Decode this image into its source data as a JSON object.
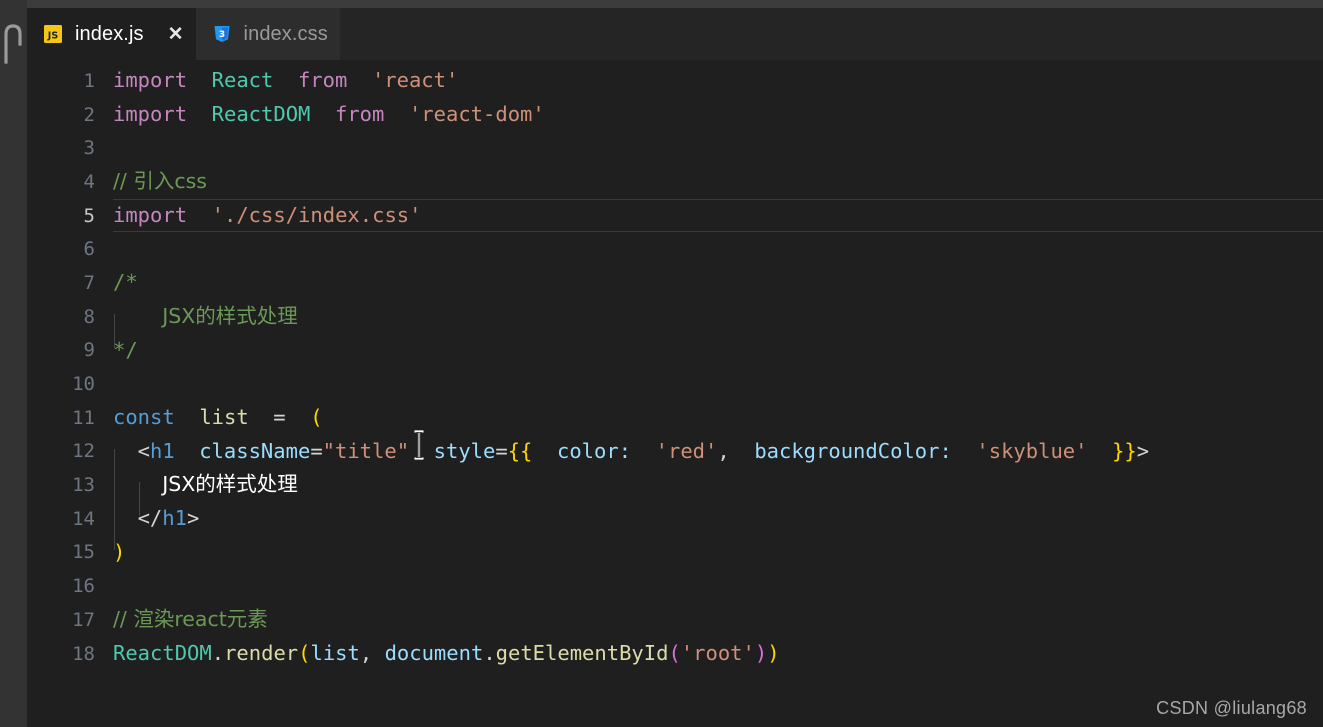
{
  "window": {
    "active_file": "index.js",
    "theme_bg": "#1f1f1f",
    "accent": "#569cd6"
  },
  "activity_bar": {
    "icon_name": "explorer-icon"
  },
  "tabs": [
    {
      "label": "index.js",
      "icon": "javascript-file-icon",
      "icon_text": "JS",
      "active": true,
      "close_label": "✕"
    },
    {
      "label": "index.css",
      "icon": "css-file-icon",
      "icon_text": "3",
      "active": false,
      "close_label": ""
    }
  ],
  "editor": {
    "language": "javascript",
    "current_line": 5,
    "cursor_marker": "text-ibeam",
    "lines": [
      {
        "n": "1",
        "text": "import React from 'react'"
      },
      {
        "n": "2",
        "text": "import ReactDOM from 'react-dom'"
      },
      {
        "n": "3",
        "text": ""
      },
      {
        "n": "4",
        "text": "// 引入css"
      },
      {
        "n": "5",
        "text": "import './css/index.css'"
      },
      {
        "n": "6",
        "text": ""
      },
      {
        "n": "7",
        "text": "/*"
      },
      {
        "n": "8",
        "text": "   JSX的样式处理"
      },
      {
        "n": "9",
        "text": "*/"
      },
      {
        "n": "10",
        "text": ""
      },
      {
        "n": "11",
        "text": "const list = ("
      },
      {
        "n": "12",
        "text": "  <h1 className=\"title\" style={{ color: 'red', backgroundColor: 'skyblue' }}>"
      },
      {
        "n": "13",
        "text": "    JSX的样式处理"
      },
      {
        "n": "14",
        "text": "  </h1>"
      },
      {
        "n": "15",
        "text": ")"
      },
      {
        "n": "16",
        "text": ""
      },
      {
        "n": "17",
        "text": "// 渲染react元素"
      },
      {
        "n": "18",
        "text": "ReactDOM.render(list, document.getElementById('root'))"
      }
    ],
    "tokens": {
      "l1": {
        "import": "import",
        "react_ident": "React",
        "from": "from",
        "module": "'react'"
      },
      "l2": {
        "import": "import",
        "reactdom_ident": "ReactDOM",
        "from": "from",
        "module": "'react-dom'"
      },
      "l4": {
        "comment": "// 引入css"
      },
      "l5": {
        "import": "import",
        "module": "'./css/index.css'"
      },
      "l7": {
        "comment_open": "/*"
      },
      "l8": {
        "comment_body": "JSX的样式处理"
      },
      "l9": {
        "comment_close": "*/"
      },
      "l11": {
        "const": "const",
        "name": "list",
        "eq": "=",
        "paren": "("
      },
      "l12": {
        "lt": "<",
        "tag": "h1",
        "prop_class": "className",
        "eq1": "=",
        "class_value": "\"title\"",
        "prop_style": "style",
        "eq2": "=",
        "brace_open": "{{",
        "key_color": "color:",
        "val_red": "'red'",
        "comma": ",",
        "key_bg": "backgroundColor:",
        "val_sky": "'skyblue'",
        "brace_close": "}}",
        "gt": ">"
      },
      "l13": {
        "text": "JSX的样式处理"
      },
      "l14": {
        "lt": "</",
        "tag": "h1",
        "gt": ">"
      },
      "l15": {
        "paren": ")"
      },
      "l17": {
        "comment": "// 渲染react元素"
      },
      "l18": {
        "obj": "ReactDOM",
        "dot1": ".",
        "method": "render",
        "open": "(",
        "arg1": "list",
        "comma": ", ",
        "doc": "document",
        "dot2": ".",
        "getter": "getElementById",
        "open2": "(",
        "id": "'root'",
        "close2": ")",
        "close": ")"
      }
    }
  },
  "watermark": {
    "text": "CSDN @liulang68"
  }
}
